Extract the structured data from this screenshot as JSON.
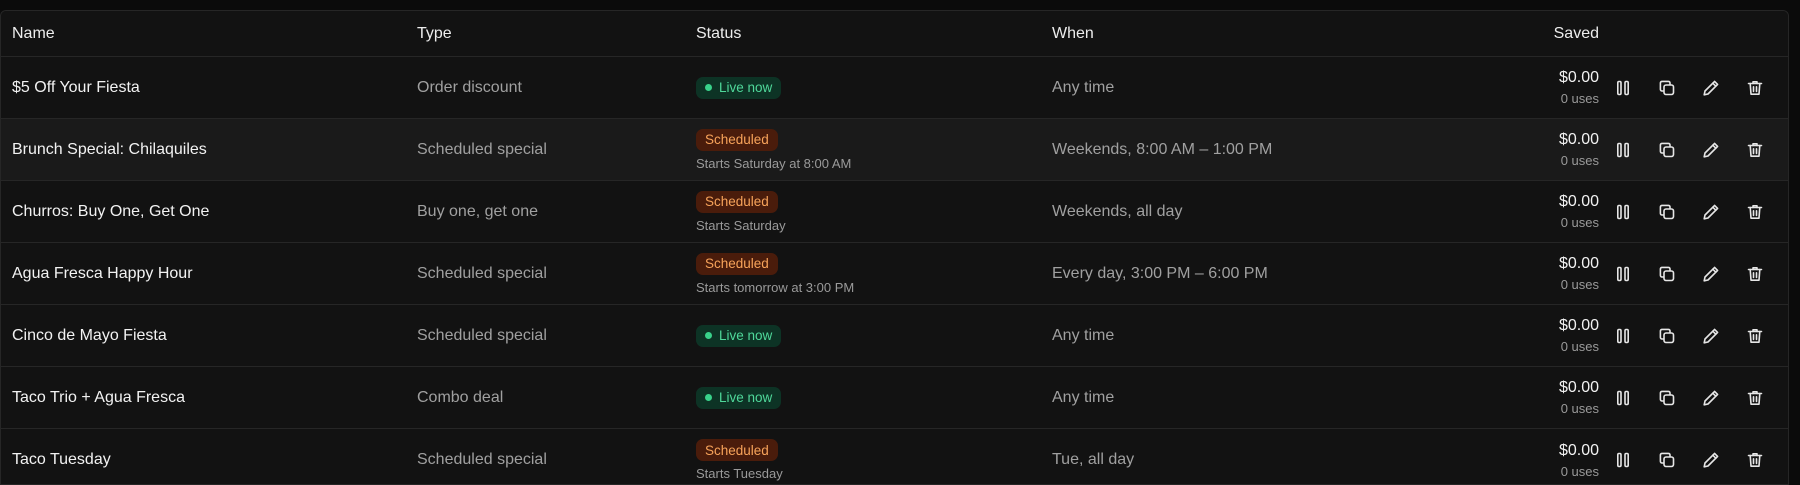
{
  "headers": {
    "name": "Name",
    "type": "Type",
    "status": "Status",
    "when": "When",
    "saved": "Saved"
  },
  "colors": {
    "live_bg": "#0d3325",
    "live_fg": "#4fd89a",
    "scheduled_bg": "#4a1c0b",
    "scheduled_fg": "#f7a35a"
  },
  "rows": [
    {
      "name": "$5 Off Your Fiesta",
      "type": "Order discount",
      "status": "Live now",
      "status_kind": "live",
      "status_detail": "",
      "when": "Any time",
      "saved": "$0.00",
      "uses": "0 uses"
    },
    {
      "name": "Brunch Special: Chilaquiles",
      "type": "Scheduled special",
      "status": "Scheduled",
      "status_kind": "scheduled",
      "status_detail": "Starts Saturday at 8:00 AM",
      "when": "Weekends, 8:00 AM – 1:00 PM",
      "saved": "$0.00",
      "uses": "0 uses"
    },
    {
      "name": "Churros: Buy One, Get One",
      "type": "Buy one, get one",
      "status": "Scheduled",
      "status_kind": "scheduled",
      "status_detail": "Starts Saturday",
      "when": "Weekends, all day",
      "saved": "$0.00",
      "uses": "0 uses"
    },
    {
      "name": "Agua Fresca Happy Hour",
      "type": "Scheduled special",
      "status": "Scheduled",
      "status_kind": "scheduled",
      "status_detail": "Starts tomorrow at 3:00 PM",
      "when": "Every day, 3:00 PM – 6:00 PM",
      "saved": "$0.00",
      "uses": "0 uses"
    },
    {
      "name": "Cinco de Mayo Fiesta",
      "type": "Scheduled special",
      "status": "Live now",
      "status_kind": "live",
      "status_detail": "",
      "when": "Any time",
      "saved": "$0.00",
      "uses": "0 uses"
    },
    {
      "name": "Taco Trio + Agua Fresca",
      "type": "Combo deal",
      "status": "Live now",
      "status_kind": "live",
      "status_detail": "",
      "when": "Any time",
      "saved": "$0.00",
      "uses": "0 uses"
    },
    {
      "name": "Taco Tuesday",
      "type": "Scheduled special",
      "status": "Scheduled",
      "status_kind": "scheduled",
      "status_detail": "Starts Tuesday",
      "when": "Tue, all day",
      "saved": "$0.00",
      "uses": "0 uses"
    }
  ],
  "row_actions": [
    {
      "icon": "pause-icon",
      "name": "pause-button"
    },
    {
      "icon": "duplicate-icon",
      "name": "duplicate-button"
    },
    {
      "icon": "edit-icon",
      "name": "edit-button"
    },
    {
      "icon": "trash-icon",
      "name": "delete-button"
    }
  ]
}
